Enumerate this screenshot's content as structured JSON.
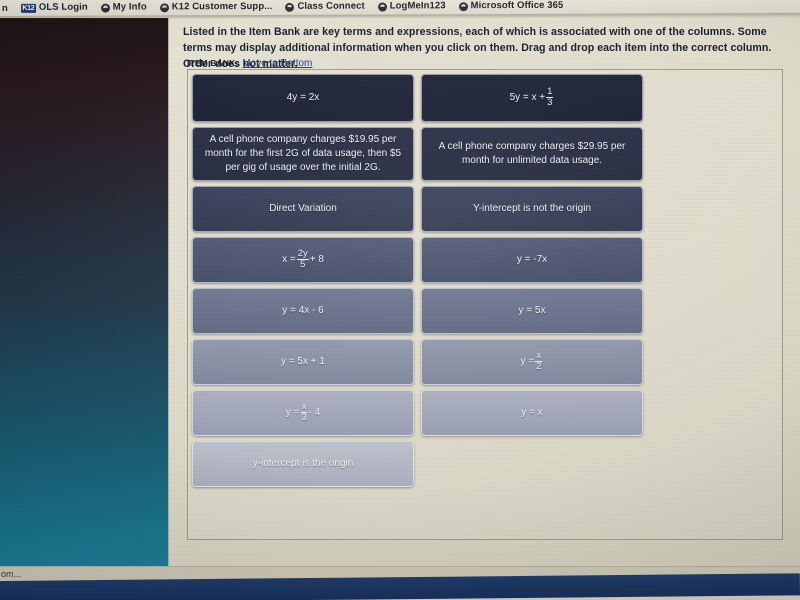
{
  "bookmarks_bar": {
    "leading_partial": "n",
    "items": [
      {
        "icon": "k12-favicon",
        "label": "OLS Login"
      },
      {
        "icon": "globe-favicon",
        "label": "My Info"
      },
      {
        "icon": "globe-favicon",
        "label": "K12 Customer Supp..."
      },
      {
        "icon": "globe-favicon",
        "label": "Class Connect"
      },
      {
        "icon": "globe-favicon",
        "label": "LogMeIn123"
      },
      {
        "icon": "globe-favicon",
        "label": "Microsoft Office 365"
      }
    ],
    "k12_badge": "K12"
  },
  "content": {
    "instructions": "Listed in the Item Bank are key terms and expressions, each of which is associated with one of the columns. Some terms may display additional information when you click on them. Drag and drop each item into the correct column. Order does not matter.",
    "item_bank_label": "ITEM BANK:",
    "move_to_bottom_link": "Move to Bottom"
  },
  "item_bank": {
    "rows": [
      {
        "height": "h-tall",
        "tiles": [
          {
            "shade": "sh0",
            "kind": "plain",
            "text": "4y = 2x"
          },
          {
            "shade": "sh0",
            "kind": "fraction",
            "prefix": "5y = x + ",
            "num": "1",
            "den": "3",
            "suffix": ""
          }
        ]
      },
      {
        "height": "h-xtall",
        "tiles": [
          {
            "shade": "sh1",
            "kind": "plain",
            "text": "A cell phone company charges $19.95 per month for the first 2G of data usage, then $5 per gig of usage over the initial 2G."
          },
          {
            "shade": "sh1",
            "kind": "plain",
            "text": "A cell phone company charges $29.95 per month for unlimited data usage."
          }
        ]
      },
      {
        "height": "h-std",
        "tiles": [
          {
            "shade": "sh2",
            "kind": "plain",
            "text": "Direct Variation"
          },
          {
            "shade": "sh2",
            "kind": "plain",
            "text": "Y-intercept is not the origin"
          }
        ]
      },
      {
        "height": "h-std",
        "tiles": [
          {
            "shade": "sh3",
            "kind": "fraction",
            "prefix": "x = ",
            "num": "2y",
            "den": "5",
            "suffix": " + 8"
          },
          {
            "shade": "sh3",
            "kind": "plain",
            "text": "y = -7x"
          }
        ]
      },
      {
        "height": "h-std",
        "tiles": [
          {
            "shade": "sh4",
            "kind": "plain",
            "text": "y = 4x - 6"
          },
          {
            "shade": "sh4",
            "kind": "plain",
            "text": "y = 5x"
          }
        ]
      },
      {
        "height": "h-std",
        "tiles": [
          {
            "shade": "sh5",
            "kind": "plain",
            "text": "y = 5x + 1"
          },
          {
            "shade": "sh5",
            "kind": "fraction",
            "prefix": "y = ",
            "num": "x",
            "den": "2",
            "suffix": ""
          }
        ]
      },
      {
        "height": "h-std",
        "tiles": [
          {
            "shade": "sh6",
            "kind": "fraction",
            "prefix": "y = ",
            "num": "x",
            "den": "3",
            "suffix": " - 4"
          },
          {
            "shade": "sh6",
            "kind": "plain",
            "text": "y = x"
          }
        ]
      },
      {
        "height": "h-std",
        "tiles": [
          {
            "shade": "sh7",
            "kind": "plain",
            "text": "y-intercept is the origin"
          },
          {
            "shade": "empty",
            "kind": "empty",
            "text": ""
          }
        ]
      }
    ]
  },
  "status_bar": {
    "text": "om..."
  },
  "colors": {
    "link": "#1d3f86",
    "page_background": "#ddd9c8",
    "rail_top": "#1c0f12",
    "rail_bottom": "#1a7e95",
    "taskbar": "#1d3a6b",
    "tile_text": "#eef1f6"
  }
}
